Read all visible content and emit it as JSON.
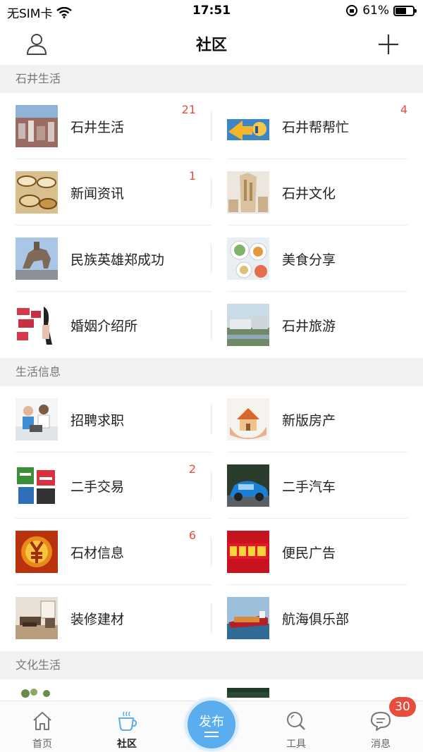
{
  "status_bar": {
    "carrier": "无SIM卡",
    "time": "17:51",
    "battery": "61%",
    "battery_level": 0.61
  },
  "nav": {
    "title": "社区",
    "profile_icon": "user-icon",
    "add_icon": "plus-icon"
  },
  "sections": [
    {
      "title": "石井生活",
      "items": [
        {
          "label": "石井生活",
          "badge": "21",
          "image": "city-view"
        },
        {
          "label": "石井帮帮忙",
          "badge": "4",
          "image": "handshake-cartoon"
        },
        {
          "label": "新闻资讯",
          "badge": "1",
          "image": "tea-cups"
        },
        {
          "label": "石井文化",
          "badge": "",
          "image": "stone-sculpture"
        },
        {
          "label": "民族英雄郑成功",
          "badge": "",
          "image": "horse-statue"
        },
        {
          "label": "美食分享",
          "badge": "",
          "image": "food-dishes"
        },
        {
          "label": "婚姻介绍所",
          "badge": "",
          "image": "dating-poster"
        },
        {
          "label": "石井旅游",
          "badge": "",
          "image": "river-town"
        }
      ]
    },
    {
      "title": "生活信息",
      "items": [
        {
          "label": "招聘求职",
          "badge": "",
          "image": "office-people"
        },
        {
          "label": "新版房产",
          "badge": "",
          "image": "house-in-hands"
        },
        {
          "label": "二手交易",
          "badge": "2",
          "image": "secondhand-sign"
        },
        {
          "label": "二手汽车",
          "badge": "",
          "image": "blue-car"
        },
        {
          "label": "石材信息",
          "badge": "6",
          "image": "yen-symbol"
        },
        {
          "label": "便民广告",
          "badge": "",
          "image": "red-ad-banner"
        },
        {
          "label": "装修建材",
          "badge": "",
          "image": "living-room"
        },
        {
          "label": "航海俱乐部",
          "badge": "",
          "image": "cargo-ship"
        }
      ]
    },
    {
      "title": "文化生活",
      "items": []
    }
  ],
  "tab_bar": {
    "tabs": [
      {
        "label": "首页",
        "icon": "home-icon"
      },
      {
        "label": "社区",
        "icon": "coffee-cup-icon"
      },
      {
        "label": "发布",
        "icon": "publish-icon"
      },
      {
        "label": "工具",
        "icon": "search-circle-icon"
      },
      {
        "label": "消息",
        "icon": "chat-bubble-icon",
        "badge": "30"
      }
    ]
  },
  "colors": {
    "accent": "#5aaef0",
    "badge_red": "#e44d3f",
    "section_bg": "#f2f2f2"
  }
}
